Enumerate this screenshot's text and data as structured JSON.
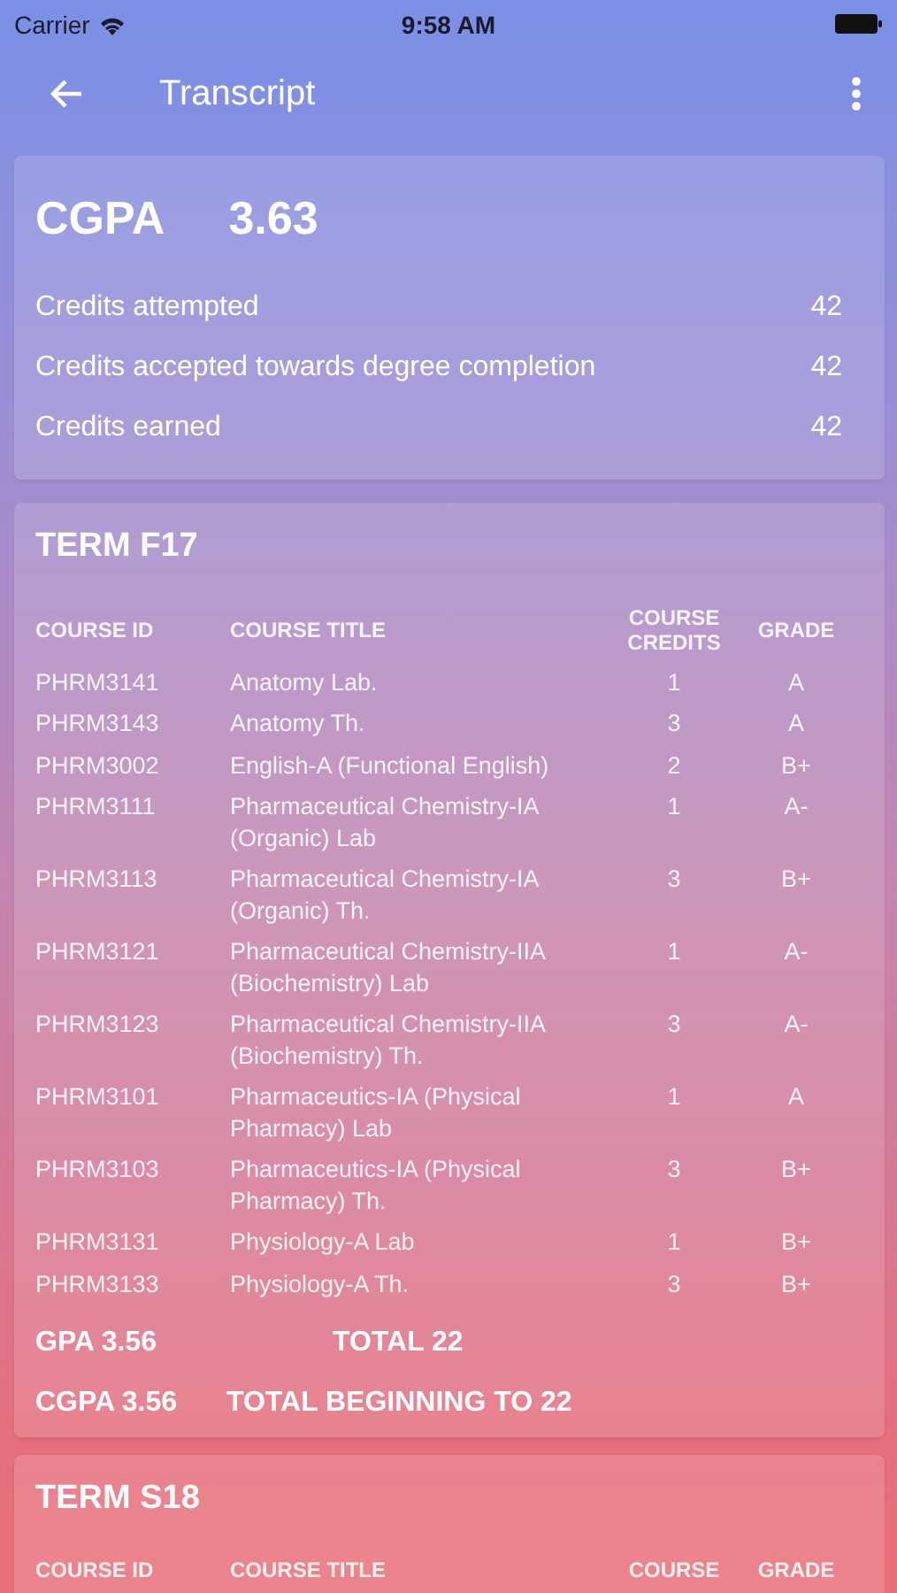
{
  "status_bar": {
    "carrier": "Carrier",
    "time": "9:58 AM"
  },
  "nav": {
    "title": "Transcript"
  },
  "summary": {
    "cgpa_label": "CGPA",
    "cgpa_value": "3.63",
    "rows": [
      {
        "label": "Credits attempted",
        "value": "42"
      },
      {
        "label": "Credits accepted towards degree completion",
        "value": "42"
      },
      {
        "label": "Credits earned",
        "value": "42"
      }
    ]
  },
  "terms": [
    {
      "title": "TERM F17",
      "columns": [
        "COURSE ID",
        "COURSE TITLE",
        "COURSE CREDITS",
        "GRADE"
      ],
      "rows": [
        {
          "id": "PHRM3141",
          "title": "Anatomy Lab.",
          "credits": "1",
          "grade": "A"
        },
        {
          "id": "PHRM3143",
          "title": "Anatomy Th.",
          "credits": "3",
          "grade": "A"
        },
        {
          "id": "PHRM3002",
          "title": "English-A (Functional English)",
          "credits": "2",
          "grade": "B+"
        },
        {
          "id": "PHRM3111",
          "title": "Pharmaceutical  Chemistry-IA (Organic) Lab",
          "credits": "1",
          "grade": "A-"
        },
        {
          "id": "PHRM3113",
          "title": "Pharmaceutical  Chemistry-IA (Organic) Th.",
          "credits": "3",
          "grade": "B+"
        },
        {
          "id": "PHRM3121",
          "title": "Pharmaceutical Chemistry-IIA (Biochemistry) Lab",
          "credits": "1",
          "grade": "A-"
        },
        {
          "id": "PHRM3123",
          "title": "Pharmaceutical Chemistry-IIA (Biochemistry) Th.",
          "credits": "3",
          "grade": "A-"
        },
        {
          "id": "PHRM3101",
          "title": "Pharmaceutics-IA (Physical Pharmacy) Lab",
          "credits": "1",
          "grade": "A"
        },
        {
          "id": "PHRM3103",
          "title": "Pharmaceutics-IA (Physical Pharmacy) Th.",
          "credits": "3",
          "grade": "B+"
        },
        {
          "id": "PHRM3131",
          "title": "Physiology-A Lab",
          "credits": "1",
          "grade": "B+"
        },
        {
          "id": "PHRM3133",
          "title": "Physiology-A Th.",
          "credits": "3",
          "grade": "B+"
        }
      ],
      "gpa": "GPA 3.56",
      "total": "TOTAL 22",
      "cgpa": "CGPA 3.56",
      "total_beginning": "TOTAL BEGINNING TO 22"
    },
    {
      "title": "TERM S18",
      "columns": [
        "COURSE ID",
        "COURSE TITLE",
        "COURSE",
        "GRADE"
      ]
    }
  ]
}
